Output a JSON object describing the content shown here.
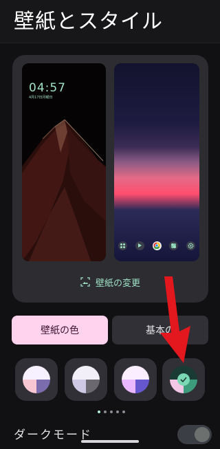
{
  "header": {
    "title": "壁紙とスタイル"
  },
  "preview": {
    "lock_time": "04:57",
    "lock_date": "4月17日月曜日",
    "change_label": "壁紙の変更",
    "dock_icons": [
      "apps-icon",
      "play-icon",
      "chrome-icon",
      "photos-icon",
      "settings-icon"
    ]
  },
  "tabs": [
    {
      "label": "壁紙の色",
      "selected": true
    },
    {
      "label": "基本の",
      "selected": false
    }
  ],
  "swatches": [
    {
      "colors": [
        "#f6f0ff",
        "#f8c5d2",
        "#7b6dad",
        "#ffffff"
      ],
      "selected": false
    },
    {
      "colors": [
        "#f2eff8",
        "#cfc9e5",
        "#6c6870",
        "#ffffff"
      ],
      "selected": false
    },
    {
      "colors": [
        "#fbeefe",
        "#e9b8ff",
        "#6657cf",
        "#ffffff"
      ],
      "selected": false
    },
    {
      "colors": [
        "#1a3b33",
        "#f1c7e5",
        "#3c9c7c",
        "#7ad9b4"
      ],
      "selected": true
    }
  ],
  "pager": {
    "count": 5,
    "active": 0
  },
  "settings": {
    "dark_mode_label": "ダークモード",
    "dark_mode_enabled": false
  },
  "colors": {
    "accent": "#9fe2c6",
    "tab_selected_bg": "#ffd3ee",
    "annotation_arrow": "#e3171e"
  }
}
